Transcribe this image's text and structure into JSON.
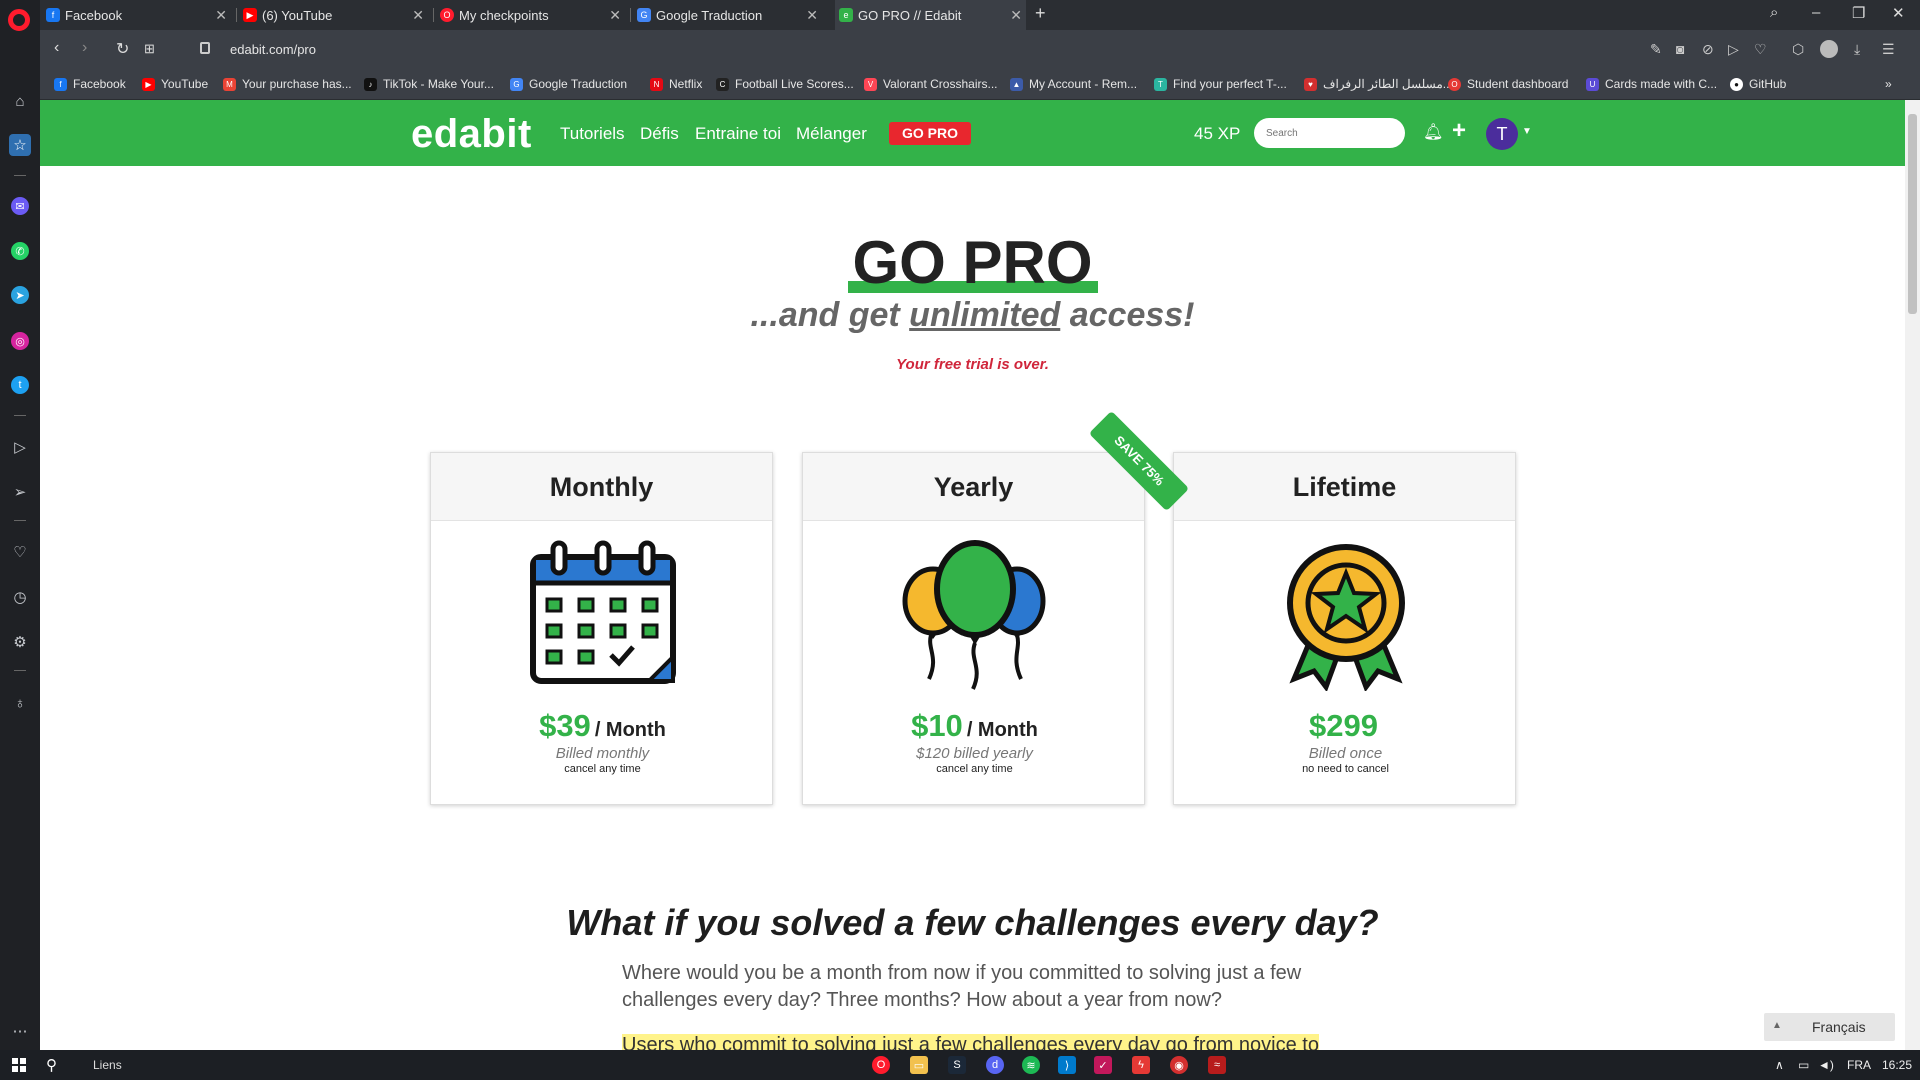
{
  "browser": {
    "tabs": [
      {
        "label": "Facebook",
        "icon": "facebook-icon",
        "active": false
      },
      {
        "label": "(6) YouTube",
        "icon": "youtube-icon",
        "active": false
      },
      {
        "label": "My checkpoints",
        "icon": "opera-icon",
        "active": false
      },
      {
        "label": "Google Traduction",
        "icon": "google-translate-icon",
        "active": false
      },
      {
        "label": "GO PRO // Edabit",
        "icon": "edabit-icon",
        "active": true
      }
    ],
    "url": "edabit.com/pro",
    "bookmarks": [
      {
        "label": "Facebook",
        "color": "#1877f2"
      },
      {
        "label": "YouTube",
        "color": "#ff0000"
      },
      {
        "label": "Your purchase has...",
        "color": "#ea4335"
      },
      {
        "label": "TikTok - Make Your...",
        "color": "#111111"
      },
      {
        "label": "Google Traduction",
        "color": "#4285f4"
      },
      {
        "label": "Netflix",
        "color": "#e50914"
      },
      {
        "label": "Football Live Scores...",
        "color": "#222222"
      },
      {
        "label": "Valorant Crosshairs...",
        "color": "#ff4655"
      },
      {
        "label": "My Account - Rem...",
        "color": "#3c5ba9"
      },
      {
        "label": "Find your perfect T-...",
        "color": "#2bb5a0"
      },
      {
        "label": "مسلسل الطائر الرفراف...",
        "color": "#d32f2f"
      },
      {
        "label": "Student dashboard",
        "color": "#e53935"
      },
      {
        "label": "Cards made with C...",
        "color": "#5b4bd6"
      },
      {
        "label": "GitHub",
        "color": "#ffffff"
      }
    ]
  },
  "nav": {
    "brand": "edabit",
    "links": [
      "Tutoriels",
      "Défis",
      "Entraine toi",
      "Mélanger"
    ],
    "gopro": "GO PRO",
    "xp": "45 XP",
    "search_placeholder": "Search",
    "avatar_letter": "T"
  },
  "hero": {
    "title": "GO PRO",
    "subtitle_pre": "...and get ",
    "subtitle_u": "unlimited",
    "subtitle_post": " access!",
    "trial": "Your free trial is over."
  },
  "plans": [
    {
      "name": "Monthly",
      "price": "$39",
      "unit": "/ Month",
      "billed": "Billed monthly",
      "note": "cancel any time"
    },
    {
      "name": "Yearly",
      "price": "$10",
      "unit": "/ Month",
      "billed": "$120 billed yearly",
      "note": "cancel any time"
    },
    {
      "name": "Lifetime",
      "price": "$299",
      "unit": "",
      "billed": "Billed once",
      "note": "no need to cancel"
    }
  ],
  "ribbon": "SAVE 75%",
  "section": {
    "title": "What if you solved a few challenges every day?",
    "paragraph": "Where would you be a month from now if you committed to solving just a few challenges every day? Three months? How about a year from now?",
    "highlight": "Users who commit to solving just a few challenges every day go from novice to"
  },
  "language": "Français",
  "taskbar": {
    "liens": "Liens",
    "lang": "FRA",
    "time": "16:25"
  },
  "colors": {
    "brand_green": "#33b249",
    "gopro_red": "#e8272e",
    "trial_red": "#d0263b"
  }
}
